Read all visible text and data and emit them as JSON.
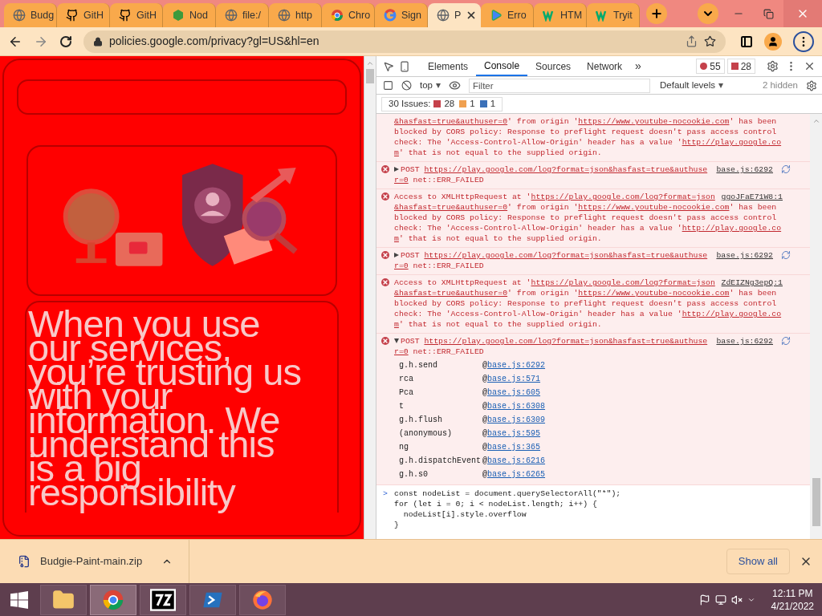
{
  "browser": {
    "tabs": [
      {
        "title": "Budg",
        "kind": "globe",
        "selected": false
      },
      {
        "title": "GitH",
        "kind": "github",
        "selected": false
      },
      {
        "title": "GitH",
        "kind": "github",
        "selected": false
      },
      {
        "title": "Nod",
        "kind": "node",
        "selected": false
      },
      {
        "title": "file:/",
        "kind": "globe",
        "selected": false
      },
      {
        "title": "http",
        "kind": "globe",
        "selected": false
      },
      {
        "title": "Chro",
        "kind": "chrome",
        "selected": false
      },
      {
        "title": "Sign",
        "kind": "google",
        "selected": false
      },
      {
        "title": "P",
        "kind": "globe",
        "selected": true
      },
      {
        "title": "Erro",
        "kind": "play",
        "selected": false
      },
      {
        "title": "HTM",
        "kind": "w3",
        "selected": false
      },
      {
        "title": "Tryit",
        "kind": "w3",
        "selected": false
      }
    ],
    "url": "policies.google.com/privacy?gl=US&hl=en"
  },
  "page": {
    "headline": "When you use our services, you’re trusting us with your information. We understand this is a big responsibility"
  },
  "devtools": {
    "tabs": [
      {
        "label": "Elements",
        "selected": false
      },
      {
        "label": "Console",
        "selected": true
      },
      {
        "label": "Sources",
        "selected": false
      },
      {
        "label": "Network",
        "selected": false
      }
    ],
    "more": "»",
    "error_count": "55",
    "issue_count": "28",
    "context": "top",
    "filter_placeholder": "Filter",
    "levels": "Default levels",
    "hidden": "2 hidden",
    "issues": {
      "label": "30 Issues:",
      "errors": "28",
      "warnings": "1",
      "info": "1"
    },
    "messages": [
      {
        "kind": "continued",
        "lines": [
          [
            {
              "kind": "link",
              "text": "&hasfast=true&authuser=0"
            },
            {
              "kind": "text",
              "text": "' from origin '"
            },
            {
              "kind": "link",
              "text": "https://www.youtube-nocookie.com"
            },
            {
              "kind": "text",
              "text": "' has been"
            }
          ],
          [
            {
              "kind": "text",
              "text": "blocked by CORS policy: Response to preflight request doesn't pass access control"
            }
          ],
          [
            {
              "kind": "text",
              "text": "check: The 'Access-Control-Allow-Origin' header has a value '"
            },
            {
              "kind": "link",
              "text": "http://play.google.co"
            }
          ],
          [
            {
              "kind": "link",
              "text": "m"
            },
            {
              "kind": "text",
              "text": "' that is not equal to the supplied origin."
            }
          ]
        ]
      },
      {
        "kind": "post",
        "expanded": false,
        "source": "base.js:6292",
        "lines": [
          [
            {
              "kind": "text",
              "text": "POST "
            },
            {
              "kind": "link",
              "text": "https://play.google.com/log?format=json&hasfast=true&authuse"
            }
          ],
          [
            {
              "kind": "link",
              "text": "r=0"
            },
            {
              "kind": "text",
              "text": " net::ERR_FAILED"
            }
          ]
        ]
      },
      {
        "kind": "error",
        "source": "ggoJFaE71W8:1",
        "lines": [
          [
            {
              "kind": "text",
              "text": "Access to XMLHttpRequest at '"
            },
            {
              "kind": "link",
              "text": "https://play.google.com/log?format=json"
            }
          ],
          [
            {
              "kind": "link",
              "text": "&hasfast=true&authuser=0"
            },
            {
              "kind": "text",
              "text": "' from origin '"
            },
            {
              "kind": "link",
              "text": "https://www.youtube-nocookie.com"
            },
            {
              "kind": "text",
              "text": "' has been"
            }
          ],
          [
            {
              "kind": "text",
              "text": "blocked by CORS policy: Response to preflight request doesn't pass access control"
            }
          ],
          [
            {
              "kind": "text",
              "text": "check: The 'Access-Control-Allow-Origin' header has a value '"
            },
            {
              "kind": "link",
              "text": "http://play.google.co"
            }
          ],
          [
            {
              "kind": "link",
              "text": "m"
            },
            {
              "kind": "text",
              "text": "' that is not equal to the supplied origin."
            }
          ]
        ]
      },
      {
        "kind": "post",
        "expanded": false,
        "source": "base.js:6292",
        "lines": [
          [
            {
              "kind": "text",
              "text": "POST "
            },
            {
              "kind": "link",
              "text": "https://play.google.com/log?format=json&hasfast=true&authuse"
            }
          ],
          [
            {
              "kind": "link",
              "text": "r=0"
            },
            {
              "kind": "text",
              "text": " net::ERR_FAILED"
            }
          ]
        ]
      },
      {
        "kind": "error",
        "source": "ZdEIZNg3epQ:1",
        "lines": [
          [
            {
              "kind": "text",
              "text": "Access to XMLHttpRequest at '"
            },
            {
              "kind": "link",
              "text": "https://play.google.com/log?format=json"
            }
          ],
          [
            {
              "kind": "link",
              "text": "&hasfast=true&authuser=0"
            },
            {
              "kind": "text",
              "text": "' from origin '"
            },
            {
              "kind": "link",
              "text": "https://www.youtube-nocookie.com"
            },
            {
              "kind": "text",
              "text": "' has been"
            }
          ],
          [
            {
              "kind": "text",
              "text": "blocked by CORS policy: Response to preflight request doesn't pass access control"
            }
          ],
          [
            {
              "kind": "text",
              "text": "check: The 'Access-Control-Allow-Origin' header has a value '"
            },
            {
              "kind": "link",
              "text": "http://play.google.co"
            }
          ],
          [
            {
              "kind": "link",
              "text": "m"
            },
            {
              "kind": "text",
              "text": "' that is not equal to the supplied origin."
            }
          ]
        ]
      },
      {
        "kind": "post",
        "expanded": true,
        "source": "base.js:6292",
        "lines": [
          [
            {
              "kind": "text",
              "text": "POST "
            },
            {
              "kind": "link",
              "text": "https://play.google.com/log?format=json&hasfast=true&authuse"
            }
          ],
          [
            {
              "kind": "link",
              "text": "r=0"
            },
            {
              "kind": "text",
              "text": " net::ERR_FAILED"
            }
          ]
        ],
        "stack": [
          {
            "function": "g.h.send",
            "at": "@",
            "source": "base.js:6292"
          },
          {
            "function": "rca",
            "at": "@",
            "source": "base.js:571"
          },
          {
            "function": "Pca",
            "at": "@",
            "source": "base.js:605"
          },
          {
            "function": "t",
            "at": "@",
            "source": "base.js:6308"
          },
          {
            "function": "g.h.flush",
            "at": "@",
            "source": "base.js:6309"
          },
          {
            "function": "(anonymous)",
            "at": "@",
            "source": "base.js:595"
          },
          {
            "function": "ng",
            "at": "@",
            "source": "base.js:365"
          },
          {
            "function": "g.h.dispatchEvent",
            "at": "@",
            "source": "base.js:6216"
          },
          {
            "function": "g.h.s0",
            "at": "@",
            "source": "base.js:6265"
          }
        ]
      }
    ],
    "prompt": ">",
    "input": [
      "const nodeList = document.querySelectorAll(\"*\");",
      "for (let i = 0; i < nodeList.length; i++) {",
      "  nodeList[i].style.overflow",
      "}"
    ]
  },
  "download_bar": {
    "file": "Budgie-Paint-main.zip",
    "show_all": "Show all"
  },
  "taskbar": {
    "apps": [
      {
        "kind": "explorer",
        "selected": false
      },
      {
        "kind": "chrome",
        "selected": true
      },
      {
        "kind": "archiver",
        "selected": false
      },
      {
        "kind": "powershell",
        "selected": false
      },
      {
        "kind": "firefox",
        "selected": false
      }
    ],
    "time": "12:11 PM",
    "date": "4/21/2022"
  }
}
